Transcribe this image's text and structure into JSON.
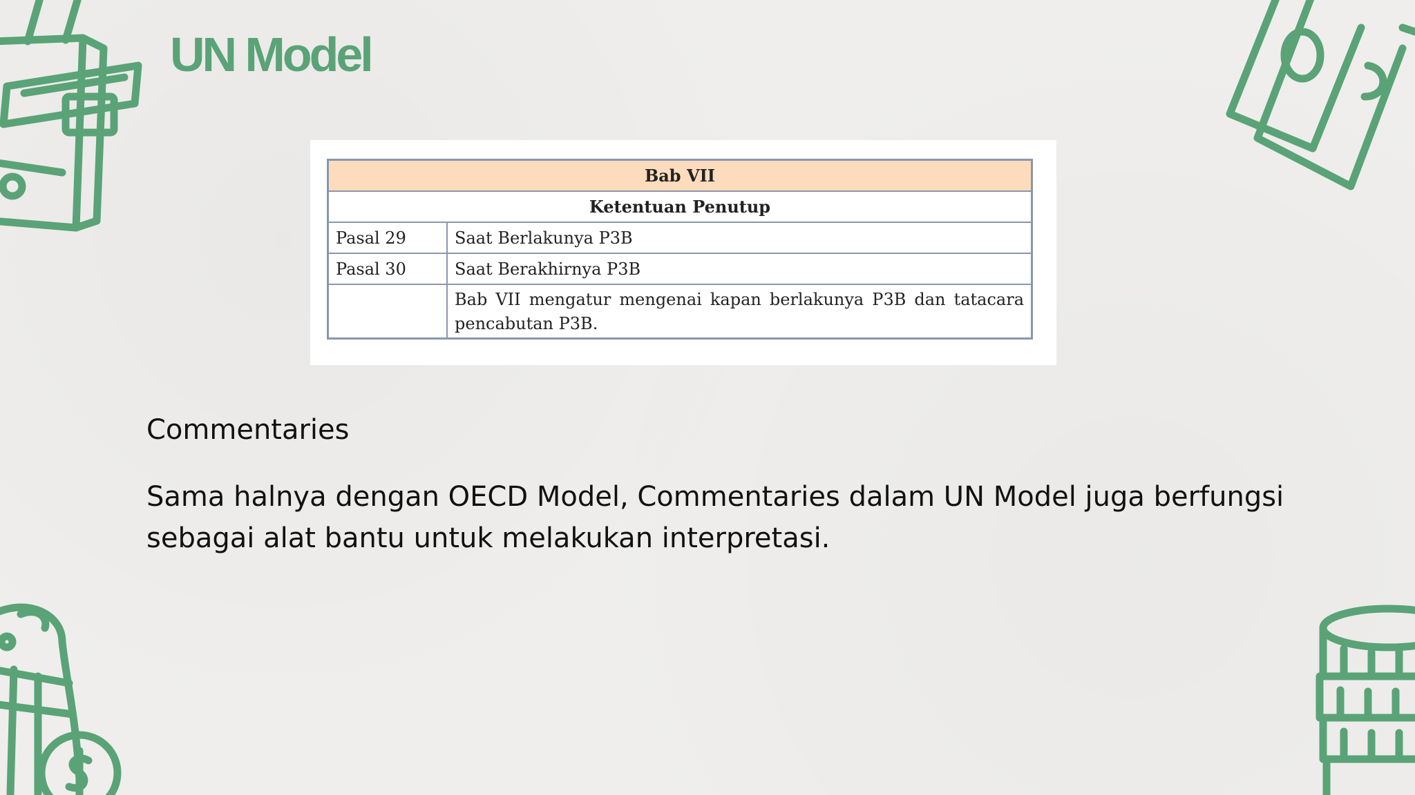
{
  "slide": {
    "title": "UN Model",
    "accent_color": "#5aa377"
  },
  "table": {
    "header": "Bab VII",
    "subheader": "Ketentuan Penutup",
    "rows": [
      {
        "pasal": "Pasal 29",
        "judul": "Saat Berlakunya P3B"
      },
      {
        "pasal": "Pasal 30",
        "judul": "Saat Berakhirnya P3B"
      },
      {
        "pasal": "",
        "judul": "Bab VII mengatur mengenai kapan berlakunya P3B dan tatacara pencabutan P3B."
      }
    ],
    "header_color": "#fcdcbc"
  },
  "commentaries": {
    "heading": "Commentaries",
    "body": "Sama halnya dengan OECD Model, Commentaries dalam UN Model juga berfungsi sebagai alat bantu untuk melakukan interpretasi."
  },
  "decorations": {
    "top_left": "wallet-icon",
    "top_right": "money-bills-icon",
    "bottom_left": "piggy-bank-icon",
    "bottom_right": "coin-stack-icon"
  }
}
